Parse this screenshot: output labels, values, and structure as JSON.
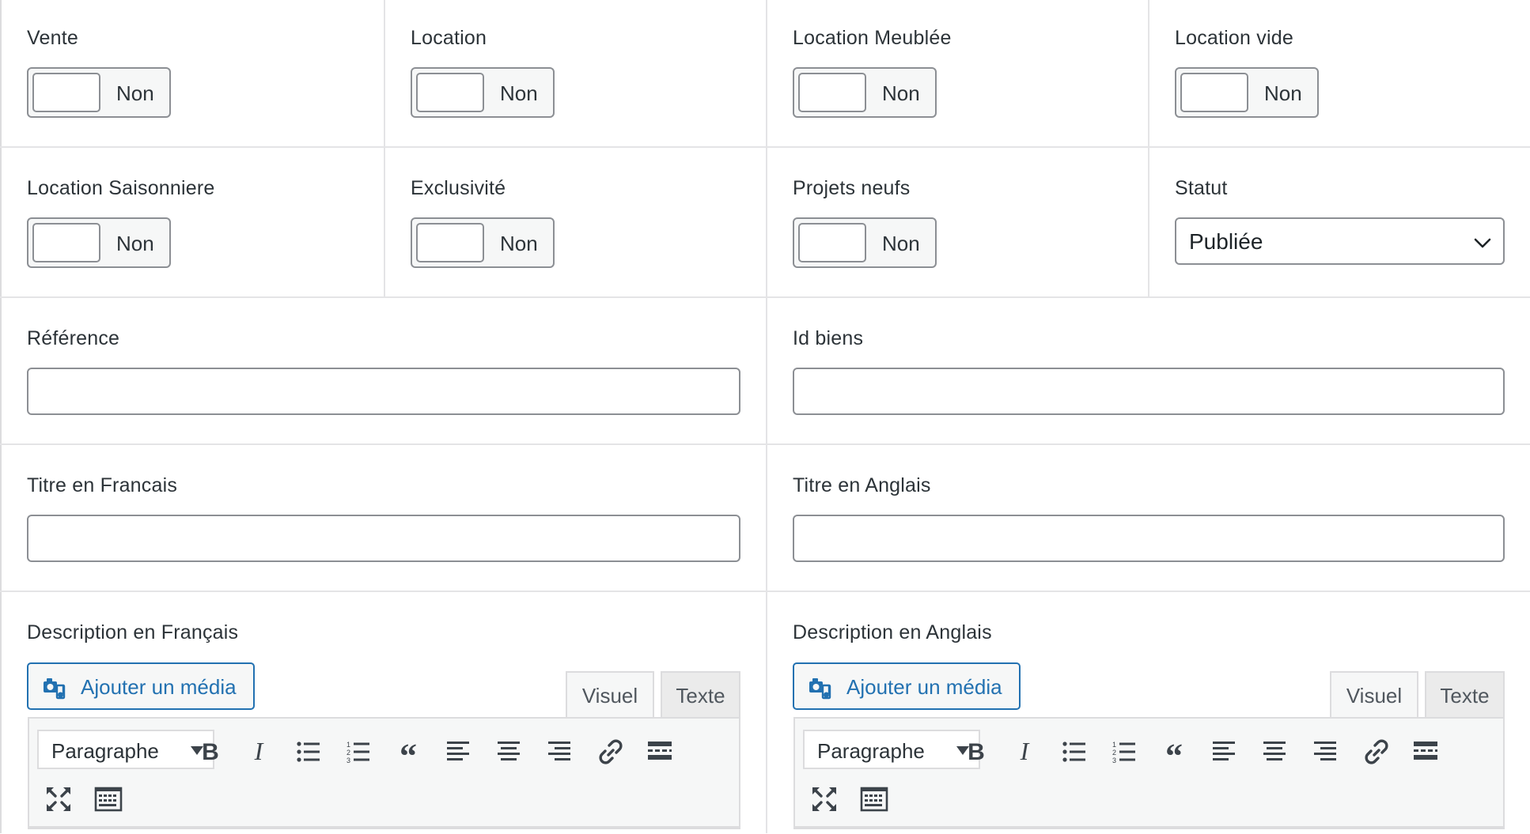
{
  "fields": {
    "vente": {
      "label": "Vente",
      "state": "Non"
    },
    "location": {
      "label": "Location",
      "state": "Non"
    },
    "location_meublee": {
      "label": "Location Meublée",
      "state": "Non"
    },
    "location_vide": {
      "label": "Location vide",
      "state": "Non"
    },
    "location_saisonniere": {
      "label": "Location Saisonniere",
      "state": "Non"
    },
    "exclusivite": {
      "label": "Exclusivité",
      "state": "Non"
    },
    "projets_neufs": {
      "label": "Projets neufs",
      "state": "Non"
    },
    "statut": {
      "label": "Statut",
      "value": "Publiée"
    },
    "reference": {
      "label": "Référence",
      "value": ""
    },
    "id_biens": {
      "label": "Id biens",
      "value": ""
    },
    "titre_fr": {
      "label": "Titre en Francais",
      "value": ""
    },
    "titre_en": {
      "label": "Titre en Anglais",
      "value": ""
    }
  },
  "editors": {
    "fr": {
      "label": "Description en Français",
      "media_button": "Ajouter un média",
      "tab_visual": "Visuel",
      "tab_text": "Texte",
      "format_select": "Paragraphe"
    },
    "en": {
      "label": "Description en Anglais",
      "media_button": "Ajouter un média",
      "tab_visual": "Visuel",
      "tab_text": "Texte",
      "format_select": "Paragraphe"
    }
  },
  "toolbar_icons": [
    "bold-icon",
    "italic-icon",
    "bullet-list-icon",
    "numbered-list-icon",
    "blockquote-icon",
    "align-left-icon",
    "align-center-icon",
    "align-right-icon",
    "link-icon",
    "read-more-icon",
    "fullscreen-icon",
    "toolbar-toggle-icon"
  ],
  "colors": {
    "accent": "#2271b1",
    "border": "#8c8f94",
    "toolbar_bg": "#f6f7f7"
  }
}
